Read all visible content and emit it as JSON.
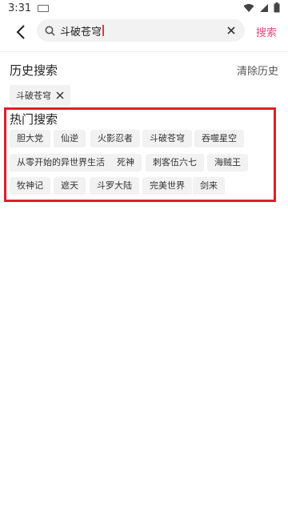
{
  "status_bar": {
    "time": "3:31"
  },
  "search": {
    "query": "斗破苍穹",
    "submit_label": "搜索"
  },
  "history": {
    "title": "历史搜索",
    "clear_label": "清除历史",
    "items": [
      "斗破苍穹"
    ]
  },
  "hot": {
    "title": "热门搜索",
    "items": [
      "胆大党",
      "仙逆",
      "火影忍者",
      "斗破苍穹",
      "吞噬星空",
      "从零开始的异世界生活",
      "死神",
      "刺客伍六七",
      "海贼王",
      "牧神记",
      "遮天",
      "斗罗大陆",
      "完美世界",
      "剑来"
    ]
  },
  "colors": {
    "accent": "#e6487a",
    "highlight_border": "#e01e2d",
    "tag_bg": "#f2f2f2"
  }
}
